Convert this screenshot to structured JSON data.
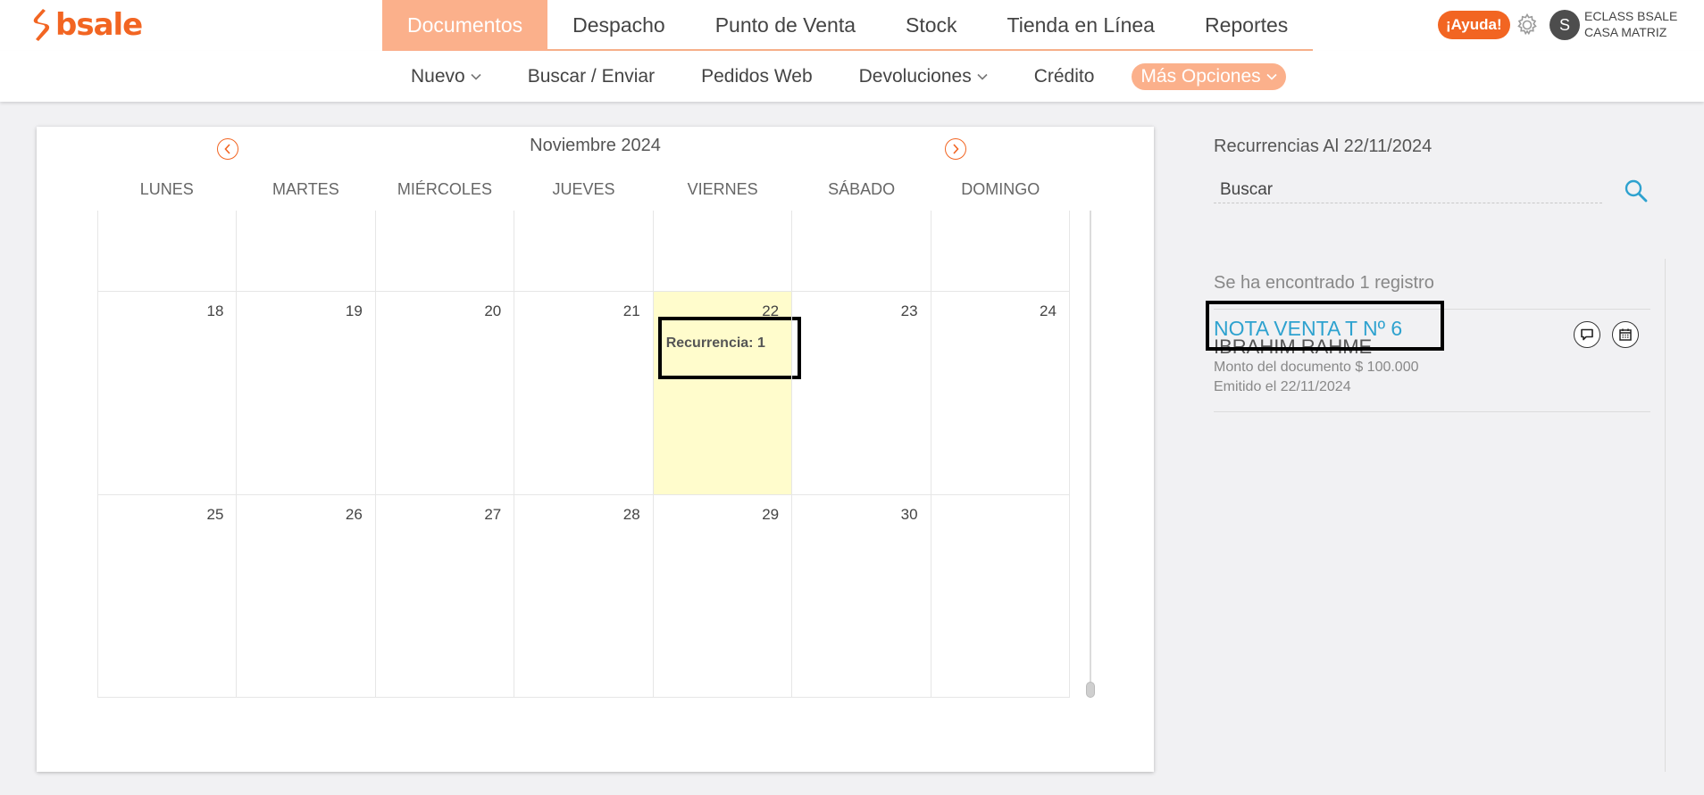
{
  "brand": {
    "name": "bsale",
    "color": "#f26522"
  },
  "main_nav": {
    "tabs": [
      {
        "label": "Documentos",
        "active": true
      },
      {
        "label": "Despacho"
      },
      {
        "label": "Punto de Venta"
      },
      {
        "label": "Stock"
      },
      {
        "label": "Tienda en Línea"
      },
      {
        "label": "Reportes"
      }
    ]
  },
  "header_right": {
    "help_label": "¡Ayuda!",
    "settings_icon": "gear-icon",
    "avatar_initial": "S",
    "company_line1": "ECLASS BSALE",
    "company_line2": "CASA MATRIZ"
  },
  "sub_nav": {
    "items": [
      {
        "label": "Nuevo",
        "dropdown": true
      },
      {
        "label": "Buscar / Enviar"
      },
      {
        "label": "Pedidos Web"
      },
      {
        "label": "Devoluciones",
        "dropdown": true
      },
      {
        "label": "Crédito"
      },
      {
        "label": "Más Opciones",
        "dropdown": true,
        "highlight": true
      }
    ]
  },
  "calendar": {
    "month_title": "Noviembre 2024",
    "weekdays": [
      "LUNES",
      "MARTES",
      "MIÉRCOLES",
      "JUEVES",
      "VIERNES",
      "SÁBADO",
      "DOMINGO"
    ],
    "weeks": [
      [
        "",
        "",
        "",
        "",
        "",
        "",
        ""
      ],
      [
        "18",
        "19",
        "20",
        "21",
        "22",
        "23",
        "24"
      ],
      [
        "25",
        "26",
        "27",
        "28",
        "29",
        "30",
        ""
      ]
    ],
    "today": "22",
    "event": {
      "day": "22",
      "label": "Recurrencia: 1"
    },
    "today_color": "#fffccc"
  },
  "recurrences": {
    "title": "Recurrencias Al 22/11/2024",
    "search_placeholder": "Buscar",
    "found_text": "Se ha encontrado 1 registro",
    "items": [
      {
        "title": "NOTA VENTA T Nº 6",
        "client": "IBRAHIM RAHME",
        "amount": "Monto del documento $ 100.000",
        "issued": "Emitido el 22/11/2024"
      }
    ]
  },
  "colors": {
    "accent_orange": "#f26522",
    "tab_active": "#fbb08b",
    "link_blue": "#2ea2cf"
  }
}
